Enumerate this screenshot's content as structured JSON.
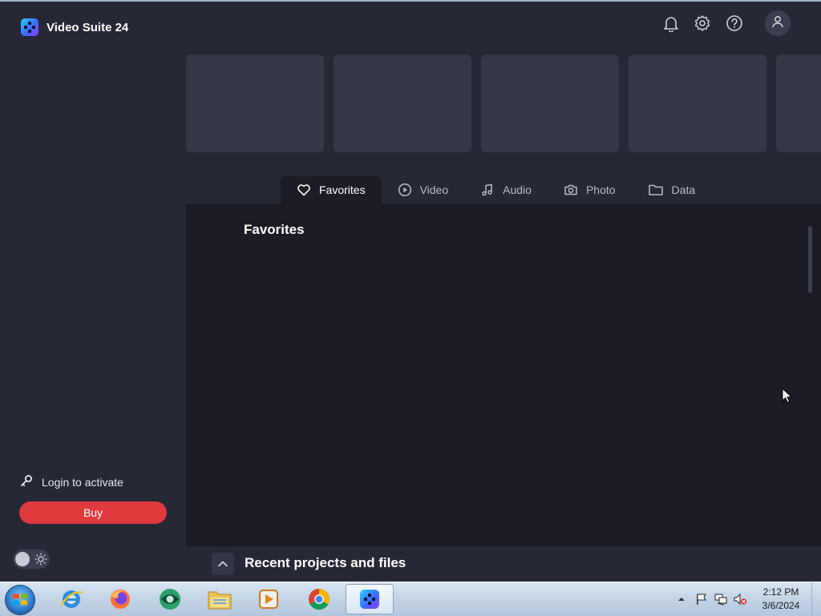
{
  "app": {
    "title": "Video Suite 24",
    "accent_color": "#e0393e"
  },
  "sidebar": {
    "login_label": "Login to activate",
    "buy_label": "Buy",
    "theme_toggle": {
      "state": "off",
      "icon": "sun-icon"
    }
  },
  "header": {
    "icons": [
      "bell-icon",
      "gear-icon",
      "help-icon",
      "user-icon"
    ]
  },
  "tabs": [
    {
      "label": "Favorites",
      "icon": "heart-icon",
      "active": true
    },
    {
      "label": "Video",
      "icon": "play-circle-icon",
      "active": false
    },
    {
      "label": "Audio",
      "icon": "music-note-icon",
      "active": false
    },
    {
      "label": "Photo",
      "icon": "camera-icon",
      "active": false
    },
    {
      "label": "Data",
      "icon": "folder-icon",
      "active": false
    }
  ],
  "main": {
    "section_title": "Favorites"
  },
  "recent": {
    "title": "Recent projects and files"
  },
  "taskbar": {
    "apps": [
      "internet-explorer-icon",
      "firefox-icon",
      "media-app-icon",
      "file-explorer-icon",
      "media-player-icon",
      "chrome-icon",
      "video-suite-icon"
    ],
    "clock": {
      "time": "2:12 PM",
      "date": "3/6/2024"
    }
  }
}
